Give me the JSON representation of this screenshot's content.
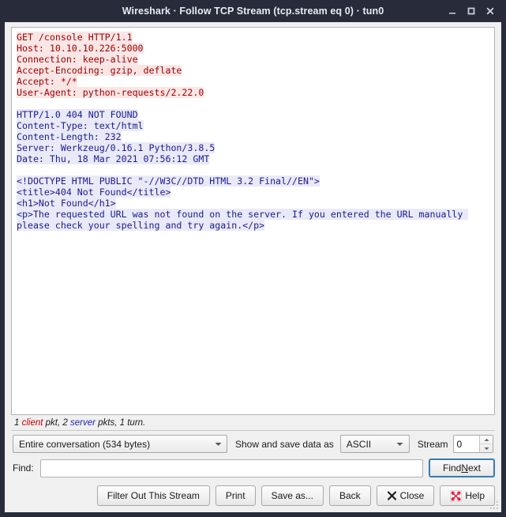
{
  "window": {
    "title": "Wireshark · Follow TCP Stream (tcp.stream eq 0) · tun0",
    "controls": {
      "minimize": "–",
      "maximize": "□",
      "close": "✕"
    },
    "colors": {
      "titlebar_bg": "#282c3a",
      "titlebar_fg": "#e8eaf0",
      "client_bg": "#f0f0f0",
      "client_text_color": "#a00000",
      "client_text_bg": "#fbe6e6",
      "server_text_color": "#1b1b8f",
      "server_text_bg": "#e9e9f8",
      "focus_border": "#3a79b8",
      "help_icon": "#e8223c"
    }
  },
  "stream": {
    "client_request": "GET /console HTTP/1.1\nHost: 10.10.10.226:5000\nConnection: keep-alive\nAccept-Encoding: gzip, deflate\nAccept: */*\nUser-Agent: python-requests/2.22.0\n",
    "server_response": "HTTP/1.0 404 NOT FOUND\nContent-Type: text/html\nContent-Length: 232\nServer: Werkzeug/0.16.1 Python/3.8.5\nDate: Thu, 18 Mar 2021 07:56:12 GMT\n",
    "server_body": "<!DOCTYPE HTML PUBLIC \"-//W3C//DTD HTML 3.2 Final//EN\">\n<title>404 Not Found</title>\n<h1>Not Found</h1>\n<p>The requested URL was not found on the server. If you entered the URL manually please check your spelling and try again.</p>\n"
  },
  "stats": {
    "client_count": "1",
    "client_word": "client",
    "client_suffix": " pkt, ",
    "server_count": "2",
    "server_word": "server",
    "server_suffix": " pkts, 1 turn."
  },
  "selectors": {
    "conversation_value": "Entire conversation (534 bytes)",
    "show_save_label": "Show and save data as",
    "format_value": "ASCII",
    "stream_label": "Stream",
    "stream_value": "0"
  },
  "find": {
    "label": "Find:",
    "value": "",
    "placeholder": "",
    "button_prefix": "Find ",
    "button_mnemonic": "N",
    "button_suffix": "ext"
  },
  "buttons": {
    "filter_out": "Filter Out This Stream",
    "print": "Print",
    "save_as": "Save as...",
    "back": "Back",
    "close": "Close",
    "help": "Help"
  }
}
